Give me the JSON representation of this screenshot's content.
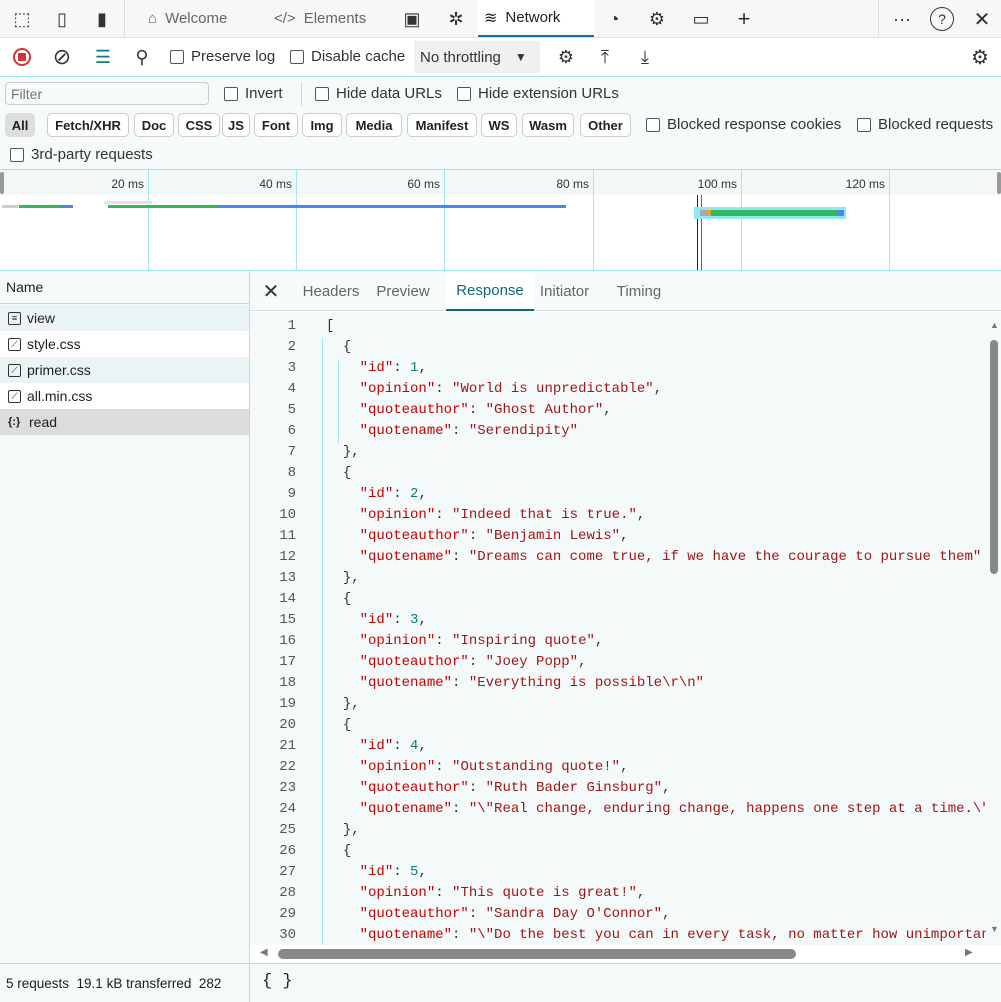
{
  "top_tabs": [
    {
      "label": "Welcome",
      "icon": "home-icon"
    },
    {
      "label": "Elements",
      "icon": "code-icon"
    },
    {
      "label": "",
      "icon": "console-icon"
    },
    {
      "label": "",
      "icon": "bug-icon"
    },
    {
      "label": "Network",
      "icon": "wifi-icon",
      "active": true
    },
    {
      "label": "",
      "icon": "performance-icon"
    },
    {
      "label": "",
      "icon": "memory-chip-icon"
    },
    {
      "label": "",
      "icon": "application-icon"
    }
  ],
  "toolbar": {
    "preserve_log": "Preserve log",
    "disable_cache": "Disable cache",
    "throttling": "No throttling"
  },
  "filters": {
    "placeholder": "Filter",
    "invert": "Invert",
    "hide_data_urls": "Hide data URLs",
    "hide_extension_urls": "Hide extension URLs",
    "types": [
      "All",
      "Fetch/XHR",
      "Doc",
      "CSS",
      "JS",
      "Font",
      "Img",
      "Media",
      "Manifest",
      "WS",
      "Wasm",
      "Other"
    ],
    "blocked_response_cookies": "Blocked response cookies",
    "blocked_requests": "Blocked requests",
    "third_party": "3rd-party requests"
  },
  "overview": {
    "ticks": [
      "20 ms",
      "40 ms",
      "60 ms",
      "80 ms",
      "100 ms",
      "120 ms"
    ]
  },
  "requests": {
    "header": "Name",
    "items": [
      {
        "name": "view",
        "icon": "document-icon"
      },
      {
        "name": "style.css",
        "icon": "stylesheet-icon"
      },
      {
        "name": "primer.css",
        "icon": "stylesheet-icon"
      },
      {
        "name": "all.min.css",
        "icon": "stylesheet-icon"
      },
      {
        "name": "read",
        "icon": "json-icon",
        "selected": true
      }
    ]
  },
  "detail_tabs": [
    "Headers",
    "Preview",
    "Response",
    "Initiator",
    "Timing"
  ],
  "response_lines": [
    "[",
    "  {",
    "    \"id\": 1,",
    "    \"opinion\": \"World is unpredictable\",",
    "    \"quoteauthor\": \"Ghost Author\",",
    "    \"quotename\": \"Serendipity\"",
    "  },",
    "  {",
    "    \"id\": 2,",
    "    \"opinion\": \"Indeed that is true.\",",
    "    \"quoteauthor\": \"Benjamin Lewis\",",
    "    \"quotename\": \"Dreams can come true, if we have the courage to pursue them\"",
    "  },",
    "  {",
    "    \"id\": 3,",
    "    \"opinion\": \"Inspiring quote\",",
    "    \"quoteauthor\": \"Joey Popp\",",
    "    \"quotename\": \"Everything is possible\\r\\n\"",
    "  },",
    "  {",
    "    \"id\": 4,",
    "    \"opinion\": \"Outstanding quote!\",",
    "    \"quoteauthor\": \"Ruth Bader Ginsburg\",",
    "    \"quotename\": \"\\\"Real change, enduring change, happens one step at a time.\\\"\"",
    "  },",
    "  {",
    "    \"id\": 5,",
    "    \"opinion\": \"This quote is great!\",",
    "    \"quoteauthor\": \"Sandra Day O'Connor\",",
    "    \"quotename\": \"\\\"Do the best you can in every task, no matter how unimportant"
  ],
  "status": {
    "summary": "5 requests  19.1 kB transferred  282",
    "format_button": "{ }"
  }
}
